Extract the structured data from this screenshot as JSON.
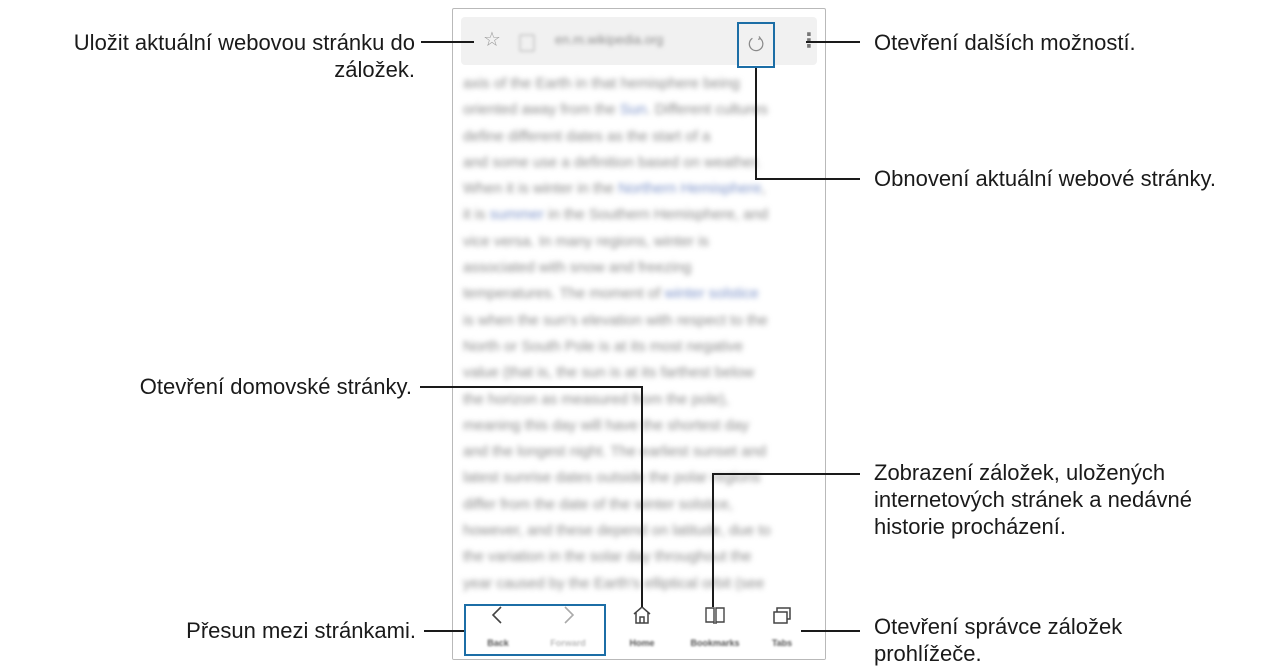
{
  "browser": {
    "url": "en.m.wikipedia.org",
    "content_lines": [
      [
        "axis of the Earth in that hemisphere being",
        "",
        ""
      ],
      [
        "oriented away from the ",
        "Sun",
        ". Different cultures"
      ],
      [
        "define different dates as the start of a ",
        "",
        ""
      ],
      [
        "and some use a definition based on weather.",
        "",
        ""
      ],
      [
        "When it is winter in the ",
        "Northern Hemisphere",
        ","
      ],
      [
        "it is ",
        "summer",
        " in the Southern Hemisphere, and"
      ],
      [
        "vice versa. In many regions, winter is",
        "",
        ""
      ],
      [
        "associated with snow and freezing",
        "",
        ""
      ],
      [
        "temperatures. The moment of ",
        "winter solstice",
        ""
      ],
      [
        "is when the sun's elevation with respect to the",
        "",
        ""
      ],
      [
        "North or South Pole is at its most negative",
        "",
        ""
      ],
      [
        "value (that is, the sun is at its farthest below",
        "",
        ""
      ],
      [
        "the horizon as measured from the pole),",
        "",
        ""
      ],
      [
        "meaning this day will have the shortest day",
        "",
        ""
      ],
      [
        "and the longest night. The earliest sunset and",
        "",
        ""
      ],
      [
        "latest sunrise dates outside the polar regions",
        "",
        ""
      ],
      [
        "differ from the date of the winter solstice,",
        "",
        ""
      ],
      [
        "however, and these depend on latitude, due to",
        "",
        ""
      ],
      [
        "the variation in the solar day throughout the",
        "",
        ""
      ],
      [
        "year caused by the Earth's elliptical orbit (see",
        "",
        ""
      ]
    ],
    "nav": {
      "back": "Back",
      "forward": "Forward",
      "home": "Home",
      "bookmarks": "Bookmarks",
      "tabs": "Tabs"
    }
  },
  "callouts": {
    "bookmark_add": "Uložit aktuální webovou stránku do záložek.",
    "more_options": "Otevření dalších možností.",
    "refresh": "Obnovení aktuální webové stránky.",
    "home": "Otevření domovské stránky.",
    "bookmarks": "Zobrazení záložek, uložených internetových stránek a nedávné historie procházení.",
    "navigation": "Přesun mezi stránkami.",
    "tabs": "Otevření správce záložek prohlížeče."
  },
  "colors": {
    "highlight": "#1c6ea6",
    "link": "#7d93c9"
  }
}
